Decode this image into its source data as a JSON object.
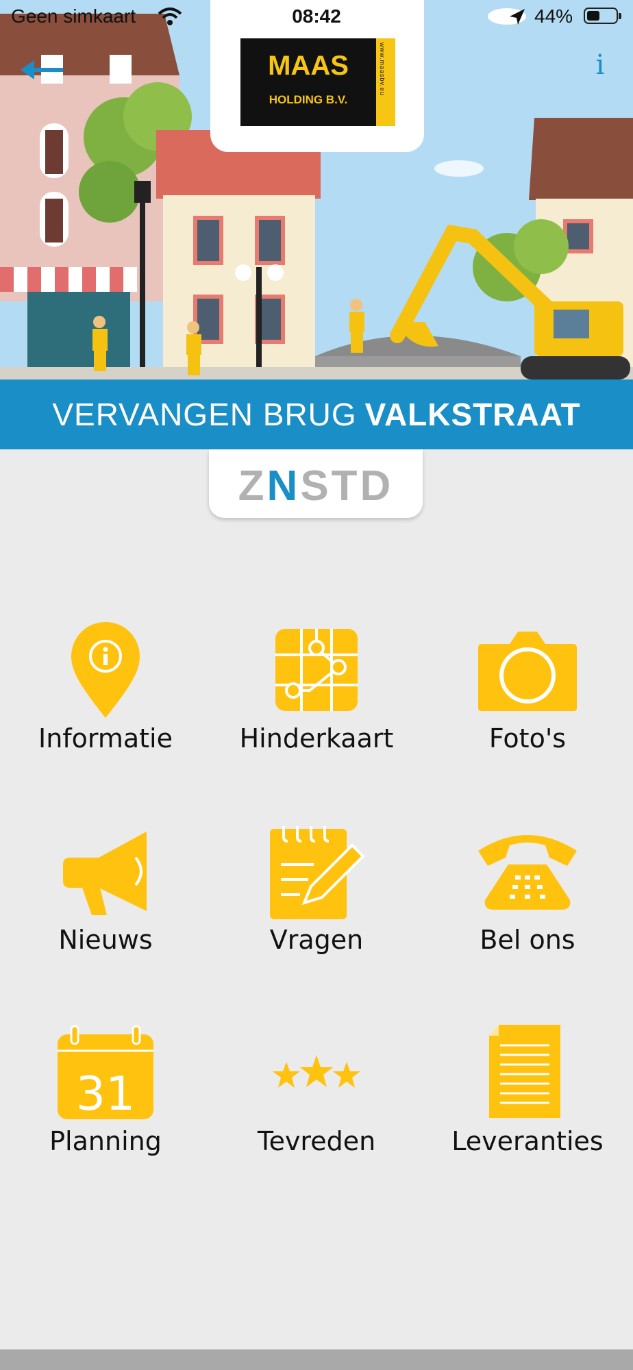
{
  "status_bar": {
    "carrier": "Geen simkaart",
    "time": "08:42",
    "battery": "44%"
  },
  "logo": {
    "name": "MAAS",
    "subtitle": "HOLDING B.V.",
    "website": "www.maasbv.eu"
  },
  "header": {
    "info_label": "i"
  },
  "banner": {
    "title_light": "VERVANGEN BRUG",
    "title_bold": "VALKSTRAAT"
  },
  "sponsor": {
    "left": "Z",
    "middle": "N",
    "right": "STD"
  },
  "menu": [
    {
      "label": "Informatie",
      "icon": "location-info-icon",
      "color": "#FFC20E"
    },
    {
      "label": "Hinderkaart",
      "icon": "map-icon",
      "color": "#FFC20E"
    },
    {
      "label": "Foto's",
      "icon": "camera-icon",
      "color": "#FFC20E"
    },
    {
      "label": "Nieuws",
      "icon": "megaphone-icon",
      "color": "#FFC20E"
    },
    {
      "label": "Vragen",
      "icon": "notepad-pencil-icon",
      "color": "#FFC20E"
    },
    {
      "label": "Bel ons",
      "icon": "telephone-icon",
      "color": "#FFC20E"
    },
    {
      "label": "Planning",
      "icon": "calendar-icon",
      "color": "#FFC20E"
    },
    {
      "label": "Tevreden",
      "icon": "three-stars-icon",
      "color": "#FFC20E"
    },
    {
      "label": "Leveranties",
      "icon": "document-icon",
      "color": "#FFC20E"
    }
  ],
  "calendar_day": "31",
  "colors": {
    "accent_blue": "#1A8EC6",
    "icon_yellow": "#FFC20E",
    "background": "#EBEBEB"
  }
}
